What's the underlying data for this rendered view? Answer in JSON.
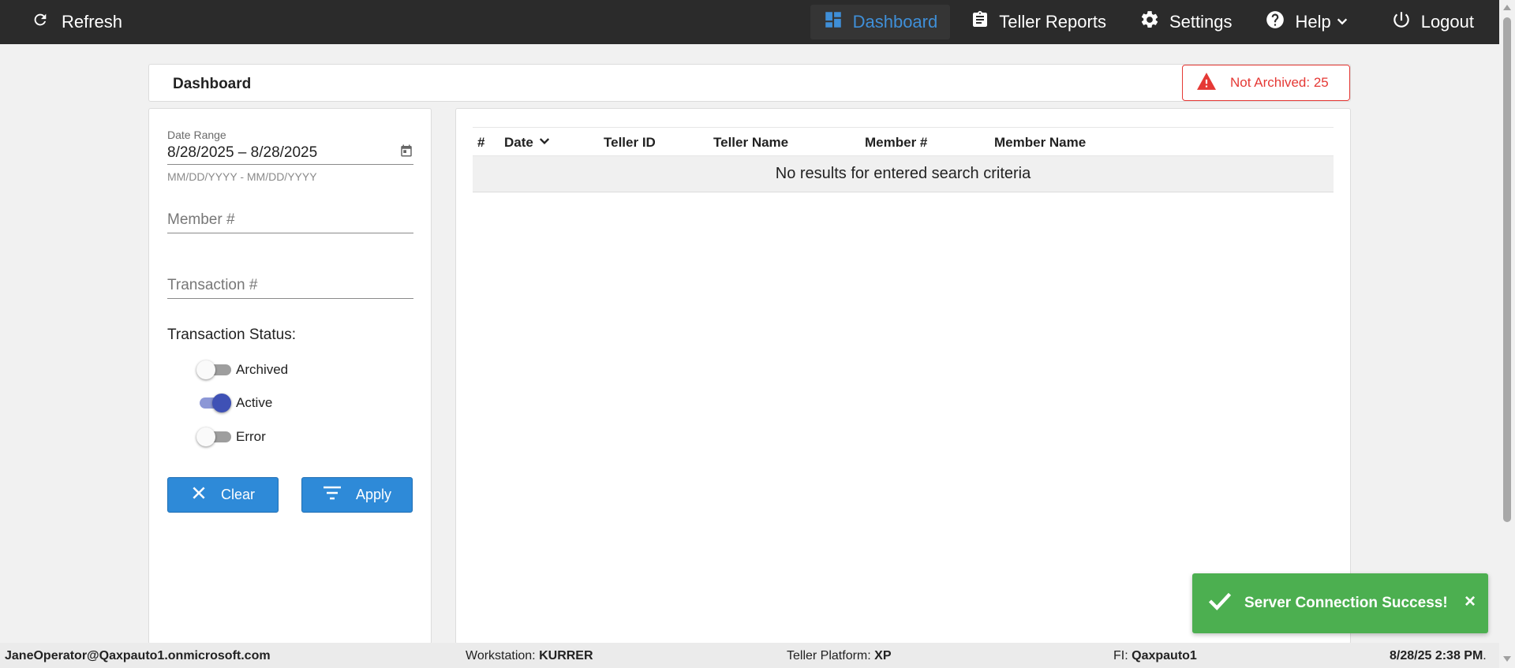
{
  "topbar": {
    "refresh_label": "Refresh",
    "nav": {
      "dashboard": "Dashboard",
      "teller_reports": "Teller Reports",
      "settings": "Settings",
      "help": "Help",
      "logout": "Logout"
    },
    "active_item": "dashboard",
    "active_color": "#3f8fd8"
  },
  "header": {
    "title": "Dashboard",
    "alert_text": "Not Archived: 25",
    "alert_color": "#e53935"
  },
  "filters": {
    "date_range_label": "Date Range",
    "date_range_value": "8/28/2025 – 8/28/2025",
    "date_range_hint": "MM/DD/YYYY - MM/DD/YYYY",
    "member_placeholder": "Member #",
    "transaction_placeholder": "Transaction #",
    "status_title": "Transaction Status:",
    "statuses": [
      {
        "label": "Archived",
        "on": false
      },
      {
        "label": "Active",
        "on": true
      },
      {
        "label": "Error",
        "on": false
      }
    ],
    "clear_label": "Clear",
    "apply_label": "Apply",
    "button_color": "#2e8ad8"
  },
  "results": {
    "columns": [
      "#",
      "Date",
      "Teller ID",
      "Teller Name",
      "Member #",
      "Member Name"
    ],
    "sorted_column": "Date",
    "empty_message": "No results for entered search criteria"
  },
  "toast": {
    "message": "Server Connection Success!",
    "close_glyph": "×",
    "color": "#4caf50"
  },
  "statusbar": {
    "user": "JaneOperator@Qaxpauto1.onmicrosoft.com",
    "workstation_label": "Workstation:",
    "workstation_value": "KURRER",
    "platform_label": "Teller Platform:",
    "platform_value": "XP",
    "fi_label": "FI:",
    "fi_value": "Qaxpauto1",
    "datetime": "8/28/25 2:38 PM",
    "datetime_suffix": "."
  }
}
